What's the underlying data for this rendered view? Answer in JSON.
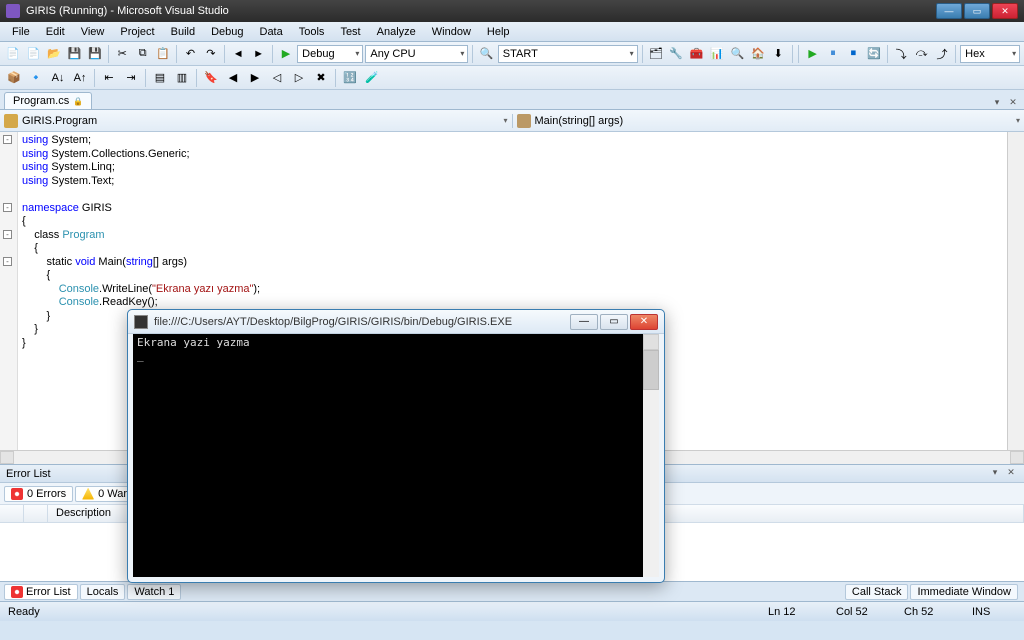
{
  "window": {
    "title": "GIRIS (Running) - Microsoft Visual Studio"
  },
  "menu": {
    "file": "File",
    "edit": "Edit",
    "view": "View",
    "project": "Project",
    "build": "Build",
    "debug": "Debug",
    "data": "Data",
    "tools": "Tools",
    "test": "Test",
    "analyze": "Analyze",
    "window": "Window",
    "help": "Help"
  },
  "toolbar": {
    "config": "Debug",
    "platform": "Any CPU",
    "find": "START",
    "display": "Hex"
  },
  "tab": {
    "name": "Program.cs"
  },
  "nav": {
    "left": "GIRIS.Program",
    "right": "Main(string[] args)"
  },
  "code": {
    "l1a": "using",
    "l1b": " System;",
    "l2a": "using",
    "l2b": " System.Collections.Generic;",
    "l3a": "using",
    "l3b": " System.Linq;",
    "l4a": "using",
    "l4b": " System.Text;",
    "l6a": "namespace",
    "l6b": " GIRIS",
    "l7": "{",
    "l8a": "    class ",
    "l8b": "Program",
    "l9": "    {",
    "l10a": "        static ",
    "l10b": "void",
    "l10c": " Main(",
    "l10d": "string",
    "l10e": "[] args)",
    "l11": "        {",
    "l12a": "            ",
    "l12b": "Console",
    "l12c": ".WriteLine(",
    "l12d": "\"Ekrana yazı yazma\"",
    "l12e": ");",
    "l13a": "            ",
    "l13b": "Console",
    "l13c": ".ReadKey();",
    "l14": "        }",
    "l15": "    }",
    "l16": "}"
  },
  "errorlist": {
    "title": "Error List",
    "errors": "0 Errors",
    "warnings": "0 Warnings",
    "col_desc": "Description"
  },
  "bottomtabs": {
    "errorlist": "Error List",
    "locals": "Locals",
    "watch": "Watch 1",
    "callstack": "Call Stack",
    "immediate": "Immediate Window"
  },
  "status": {
    "ready": "Ready",
    "ln": "Ln 12",
    "col": "Col 52",
    "ch": "Ch 52",
    "ins": "INS"
  },
  "console": {
    "title": "file:///C:/Users/AYT/Desktop/BilgProg/GIRIS/GIRIS/bin/Debug/GIRIS.EXE",
    "output": "Ekrana yazi yazma\n_"
  }
}
